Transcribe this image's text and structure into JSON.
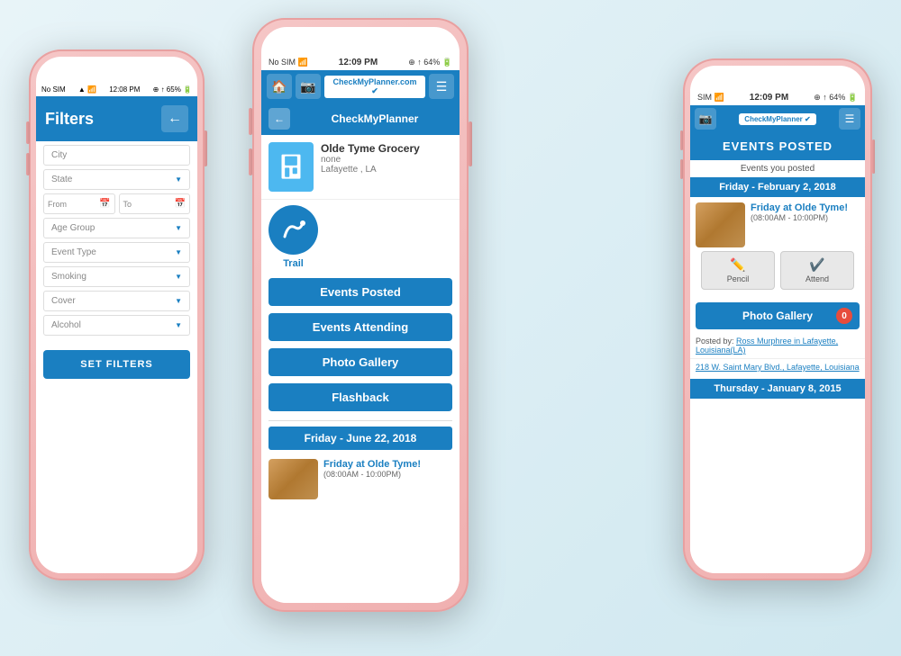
{
  "phones": {
    "left": {
      "status": {
        "carrier": "No SIM",
        "wifi": "📶",
        "time": "12:08 PM",
        "location": "⊕",
        "signal": "↑",
        "battery": "65%"
      },
      "header": {
        "title": "Filters",
        "back_label": "←"
      },
      "fields": {
        "city": "City",
        "state": "State",
        "from": "From",
        "to": "To",
        "age_group": "Age Group",
        "event_type": "Event Type",
        "smoking": "Smoking",
        "cover": "Cover",
        "alcohol": "Alcohol"
      },
      "button": "SET FILTERS"
    },
    "center": {
      "status": {
        "carrier": "No SIM",
        "wifi": "📶",
        "time": "12:09 PM",
        "location": "⊕",
        "signal": "↑",
        "battery": "64%"
      },
      "header": {
        "home_icon": "🏠",
        "camera_icon": "📷",
        "logo": "CheckMyPlanner.com",
        "menu_icon": "☰",
        "back_label": "←",
        "title": "CheckMyPlanner"
      },
      "business": {
        "name": "Olde Tyme Grocery",
        "sub": "none",
        "location": "Lafayette , LA"
      },
      "trail_label": "Trail",
      "menu_items": [
        "Events Posted",
        "Events Attending",
        "Photo Gallery",
        "Flashback"
      ],
      "date_section": "Friday - June 22, 2018",
      "event": {
        "title": "Friday at Olde Tyme!",
        "time": "(08:00AM - 10:00PM)"
      }
    },
    "right": {
      "status": {
        "carrier": "SIM",
        "wifi": "📶",
        "time": "12:09 PM",
        "location": "⊕",
        "signal": "↑",
        "battery": "64%"
      },
      "header": {
        "camera_icon": "📷",
        "logo": "CheckMyPlanner",
        "menu_icon": "☰"
      },
      "events_posted": {
        "title": "EVENTS POSTED",
        "subtitle": "Events you posted"
      },
      "date1": "Friday - February 2, 2018",
      "event1": {
        "title": "Friday at Olde Tyme!",
        "time": "(08:00AM - 10:00PM)",
        "pencil_label": "Pencil",
        "attend_label": "Attend"
      },
      "photo_gallery_btn": "Photo Gallery",
      "notification_count": "0",
      "posted_by_text": "Posted by:",
      "posted_by_name": "Ross Murphree",
      "posted_by_location": "in Lafayette, Louisiana(LA)",
      "address": "218 W. Saint Mary Blvd., Lafayette, Louisiana",
      "date2": "Thursday - January 8, 2015"
    }
  }
}
